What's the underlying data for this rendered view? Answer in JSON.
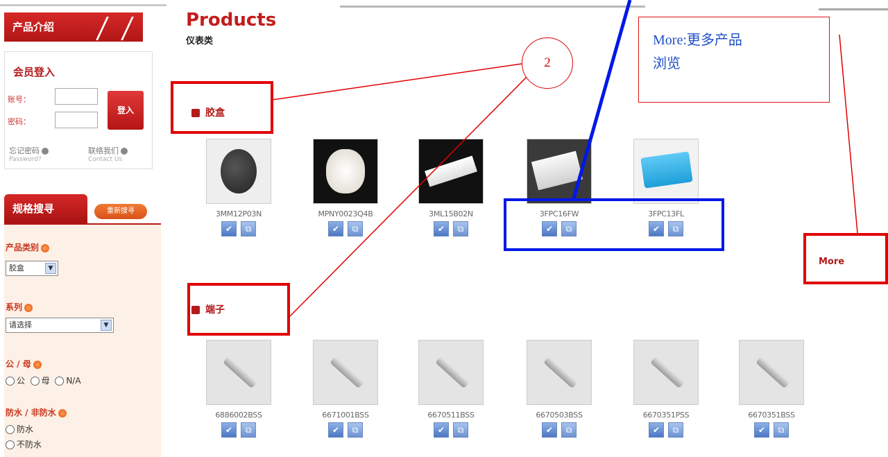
{
  "sidebar": {
    "header": "产品介绍",
    "login": {
      "title": "会员登入",
      "account_label": "账号：",
      "password_label": "密码：",
      "button": "登入",
      "forgot": "忘记密码",
      "forgot_sub": "Password?",
      "contact": "联络我们",
      "contact_sub": "Contact Us"
    },
    "spec_tab": "规格搜寻",
    "spec_pill": "重新搜寻",
    "fields": {
      "category_label": "产品类别",
      "category_value": "胶盒",
      "series_label": "系列",
      "series_value": "请选择",
      "gender_label": "公 / 母",
      "gender_options": [
        "公",
        "母",
        "N/A"
      ],
      "waterproof_label": "防水 / 非防水",
      "waterproof_options": [
        "防水",
        "不防水"
      ]
    }
  },
  "main": {
    "title": "Products",
    "subtitle": "仪表类",
    "categories": [
      {
        "name": "胶盒",
        "products": [
          "3MM12P03N",
          "MPNY0023Q4B",
          "3ML15B02N",
          "3FPC16FW",
          "3FPC13FL"
        ]
      },
      {
        "name": "端子",
        "products": [
          "6886002BSS",
          "6671001BSS",
          "6670511BSS",
          "6670503BSS",
          "6670351PSS",
          "6670351BSS"
        ]
      }
    ],
    "more": "More"
  },
  "annotations": {
    "note_line1": "More:更多产品",
    "note_line2": "浏览",
    "circle": "2"
  },
  "colors": {
    "brand_red": "#b31a1a",
    "annotation_red": "#e00000",
    "annotation_blue": "#0018e8"
  }
}
